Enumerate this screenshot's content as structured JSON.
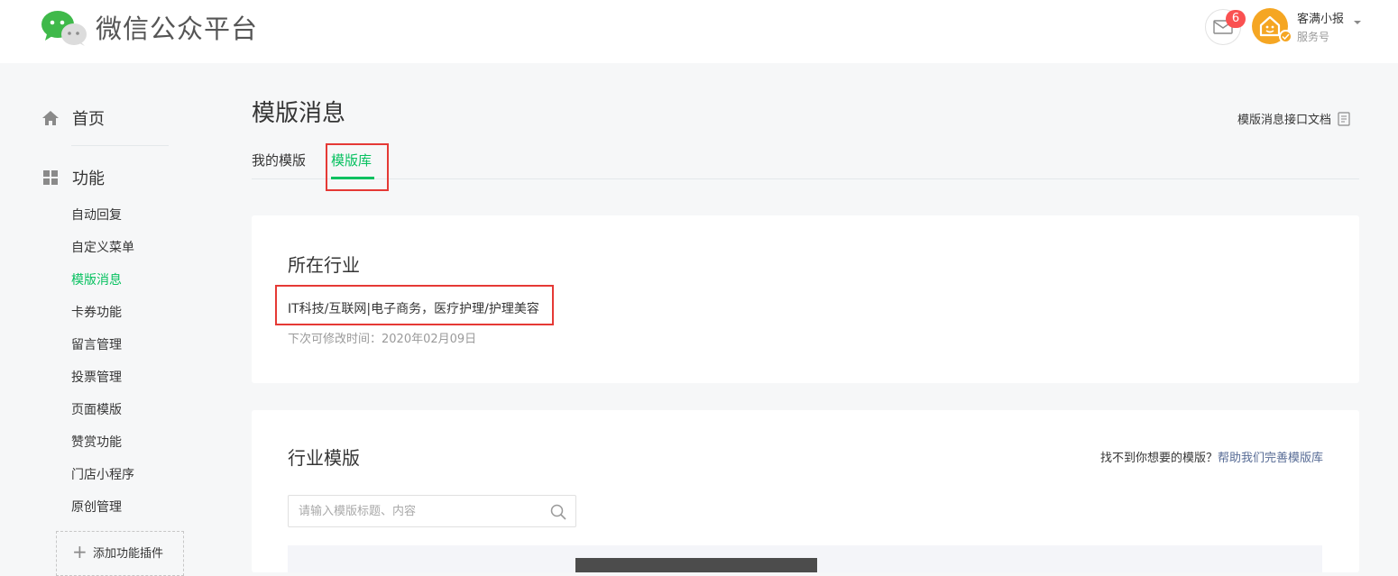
{
  "header": {
    "brand": "微信公众平台",
    "mail_badge": "6",
    "account_name": "客满小报",
    "account_type": "服务号"
  },
  "sidebar": {
    "home_label": "首页",
    "func_label": "功能",
    "items": [
      {
        "label": "自动回复",
        "active": false
      },
      {
        "label": "自定义菜单",
        "active": false
      },
      {
        "label": "模版消息",
        "active": true
      },
      {
        "label": "卡券功能",
        "active": false
      },
      {
        "label": "留言管理",
        "active": false
      },
      {
        "label": "投票管理",
        "active": false
      },
      {
        "label": "页面模版",
        "active": false
      },
      {
        "label": "赞赏功能",
        "active": false
      },
      {
        "label": "门店小程序",
        "active": false
      },
      {
        "label": "原创管理",
        "active": false
      }
    ],
    "add_plugin_label": "添加功能插件"
  },
  "main": {
    "title": "模版消息",
    "doc_link": "模版消息接口文档",
    "tabs": [
      {
        "label": "我的模版",
        "active": false
      },
      {
        "label": "模版库",
        "active": true
      }
    ],
    "industry": {
      "title": "所在行业",
      "value": "IT科技/互联网|电子商务，医疗护理/护理美容",
      "next_modify": "下次可修改时间：2020年02月09日"
    },
    "templates": {
      "title": "行业模版",
      "help_prefix": "找不到你想要的模版？",
      "help_link": "帮助我们完善模版库",
      "search_placeholder": "请输入模版标题、内容"
    }
  },
  "colors": {
    "brand_green": "#07c160",
    "highlight_red": "#e53935",
    "badge_red": "#fa5151",
    "avatar_orange": "#f5a623",
    "link_blue": "#576b95"
  }
}
